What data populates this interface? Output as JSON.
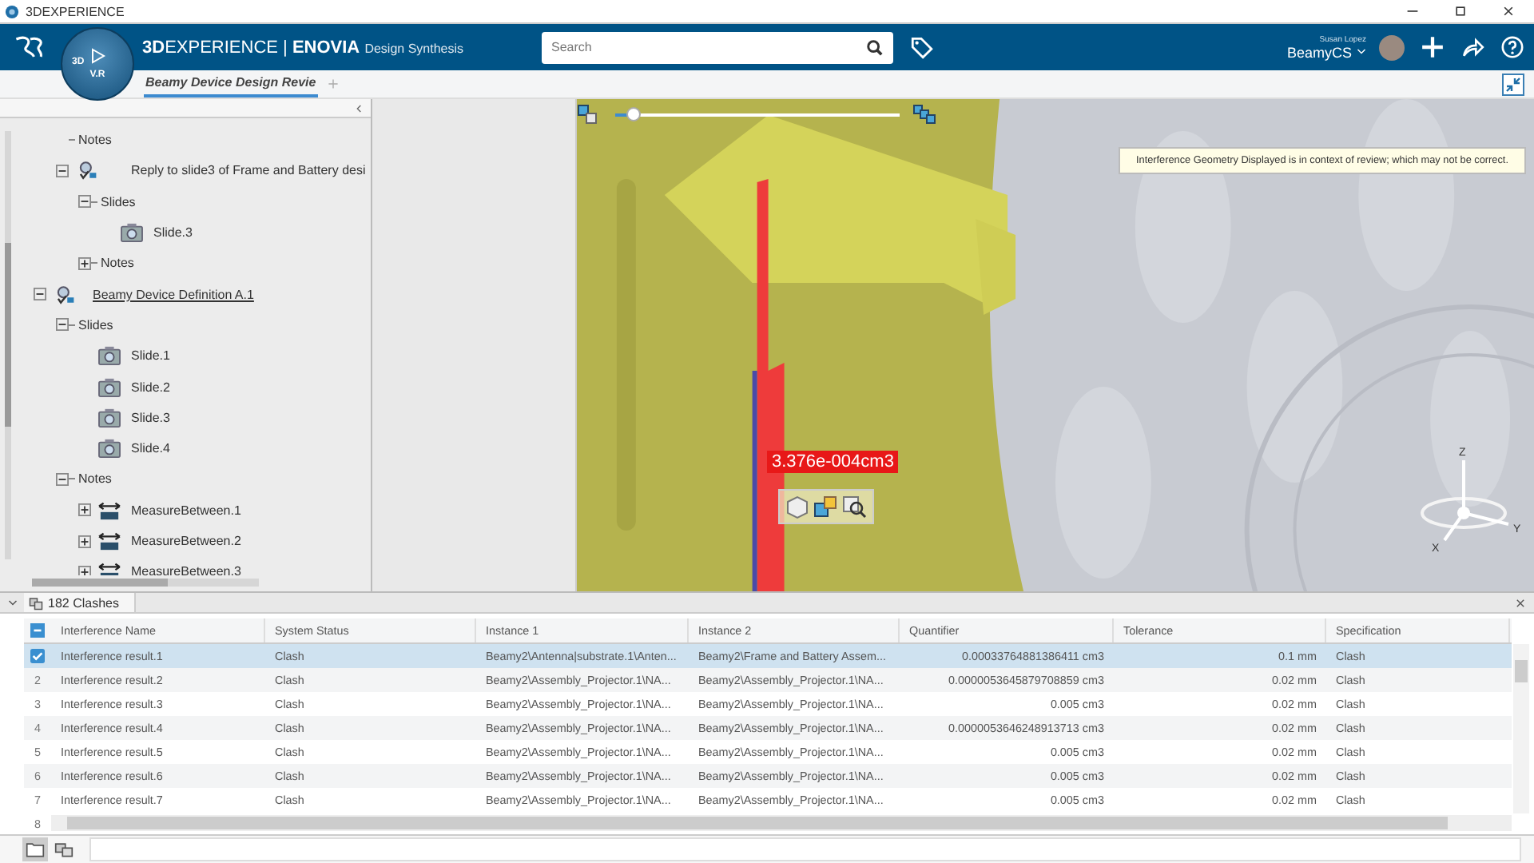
{
  "window": {
    "title": "3DEXPERIENCE"
  },
  "header": {
    "brand": "**3D**EXPERIENCE | **ENOVIA**",
    "app": "Design Synthesis",
    "compass_labels": [
      "3D",
      "V.R"
    ],
    "search": {
      "placeholder": "Search"
    },
    "user_name": "Susan Lopez",
    "tenant": "BeamyCS"
  },
  "tabs": [
    {
      "label": "Beamy Device Design Revie",
      "selected": true
    }
  ],
  "tree": {
    "continued": [
      {
        "label": "Notes",
        "kind": "folder"
      },
      {
        "label": "Reply to slide3 of Frame and Battery desi",
        "kind": "review",
        "current": false,
        "expanded": true,
        "children": [
          {
            "label": "Slides",
            "kind": "folder",
            "expanded": true,
            "children": [
              {
                "label": "Slide.3",
                "kind": "slide"
              }
            ]
          },
          {
            "label": "Notes",
            "kind": "folder",
            "expanded": false
          }
        ]
      }
    ],
    "items": [
      {
        "label": "Beamy Device Definition A.1",
        "kind": "review",
        "current": true,
        "expanded": true,
        "children": [
          {
            "label": "Slides",
            "kind": "folder",
            "expanded": true,
            "children": [
              {
                "label": "Slide.1",
                "kind": "slide"
              },
              {
                "label": "Slide.2",
                "kind": "slide"
              },
              {
                "label": "Slide.3",
                "kind": "slide"
              },
              {
                "label": "Slide.4",
                "kind": "slide"
              }
            ]
          },
          {
            "label": "Notes",
            "kind": "folder",
            "expanded": true,
            "children": [
              {
                "label": "MeasureBetween.1",
                "kind": "measure",
                "expanded": false
              },
              {
                "label": "MeasureBetween.2",
                "kind": "measure",
                "expanded": false
              },
              {
                "label": "MeasureBetween.3",
                "kind": "measure",
                "expanded": false
              }
            ]
          }
        ]
      }
    ]
  },
  "viewport": {
    "slider": {
      "level": 0.07
    },
    "measure_label": "3.376e-004cm3",
    "notice": "Interference Geometry Displayed is in context of review; which may not be correct.",
    "axes": [
      "Z",
      "Y",
      "X"
    ]
  },
  "clashes": {
    "title": "182 Clashes",
    "select_all_partial": true,
    "columns": [
      "Interference Name",
      "System Status",
      "Instance 1",
      "Instance 2",
      "Quantifier",
      "Tolerance",
      "Specification"
    ],
    "rows": [
      {
        "selected": true,
        "cells": [
          "Interference result.1",
          "Clash",
          "Beamy2\\Antenna|substrate.1\\Anten...",
          "Beamy2\\Frame and Battery Assem...",
          "0.00033764881386411 cm3",
          "0.1 mm",
          "Clash"
        ]
      },
      {
        "number": "2",
        "selected": false,
        "cells": [
          "Interference result.2",
          "Clash",
          "Beamy2\\Assembly_Projector.1\\NA...",
          "Beamy2\\Assembly_Projector.1\\NA...",
          "0.0000053645879708859 cm3",
          "0.02 mm",
          "Clash"
        ]
      },
      {
        "number": "3",
        "selected": false,
        "cells": [
          "Interference result.3",
          "Clash",
          "Beamy2\\Assembly_Projector.1\\NA...",
          "Beamy2\\Assembly_Projector.1\\NA...",
          "0.005 cm3",
          "0.02 mm",
          "Clash"
        ]
      },
      {
        "number": "4",
        "selected": false,
        "cells": [
          "Interference result.4",
          "Clash",
          "Beamy2\\Assembly_Projector.1\\NA...",
          "Beamy2\\Assembly_Projector.1\\NA...",
          "0.0000053646248913713 cm3",
          "0.02 mm",
          "Clash"
        ]
      },
      {
        "number": "5",
        "selected": false,
        "cells": [
          "Interference result.5",
          "Clash",
          "Beamy2\\Assembly_Projector.1\\NA...",
          "Beamy2\\Assembly_Projector.1\\NA...",
          "0.005 cm3",
          "0.02 mm",
          "Clash"
        ]
      },
      {
        "number": "6",
        "selected": false,
        "cells": [
          "Interference result.6",
          "Clash",
          "Beamy2\\Assembly_Projector.1\\NA...",
          "Beamy2\\Assembly_Projector.1\\NA...",
          "0.005 cm3",
          "0.02 mm",
          "Clash"
        ]
      },
      {
        "number": "7",
        "selected": false,
        "cells": [
          "Interference result.7",
          "Clash",
          "Beamy2\\Assembly_Projector.1\\NA...",
          "Beamy2\\Assembly_Projector.1\\NA...",
          "0.005 cm3",
          "0.02 mm",
          "Clash"
        ]
      }
    ],
    "more_row_number": "8"
  }
}
